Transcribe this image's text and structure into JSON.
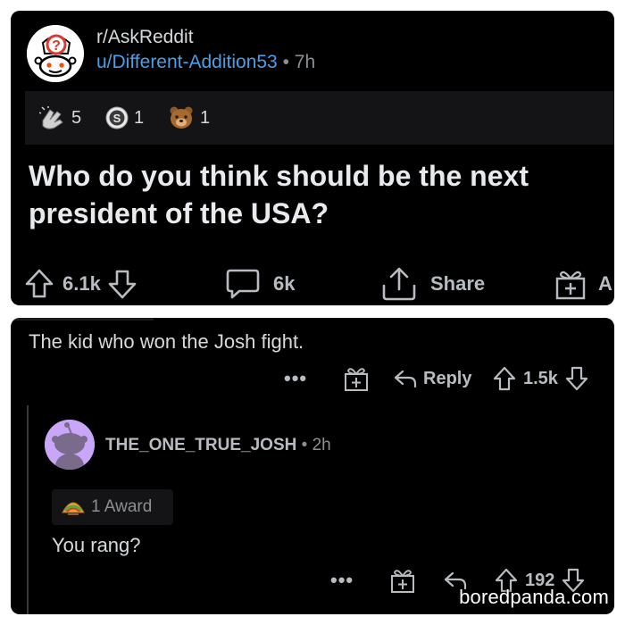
{
  "post": {
    "subreddit": "r/AskReddit",
    "username": "u/Different-Addition53",
    "separator": "•",
    "age": "7h",
    "awards": [
      {
        "icon": "clapping-hands-award-icon",
        "count": "5"
      },
      {
        "icon": "silver-coin-award-icon",
        "count": "1"
      },
      {
        "icon": "bear-face-award-icon",
        "count": "1"
      }
    ],
    "title": "Who do you think should be the next president of the USA?",
    "upvotes": "6.1k",
    "comments": "6k",
    "share_label": "Share",
    "award_label_partial": "A"
  },
  "comment": {
    "text": "The kid who won the Josh fight.",
    "more": "•••",
    "reply_label": "Reply",
    "score": "1.5k"
  },
  "reply": {
    "username": "THE_ONE_TRUE_JOSH",
    "separator": "•",
    "age": "2h",
    "award_label": "1 Award",
    "text": "You rang?",
    "more": "•••",
    "score": "192"
  },
  "watermark": "boredpanda.com",
  "colors": {
    "background": "#000000",
    "username_link": "#4a9fe6",
    "avatar_reply_bg": "#c9a6f7",
    "award_bar_bg": "#141416"
  }
}
